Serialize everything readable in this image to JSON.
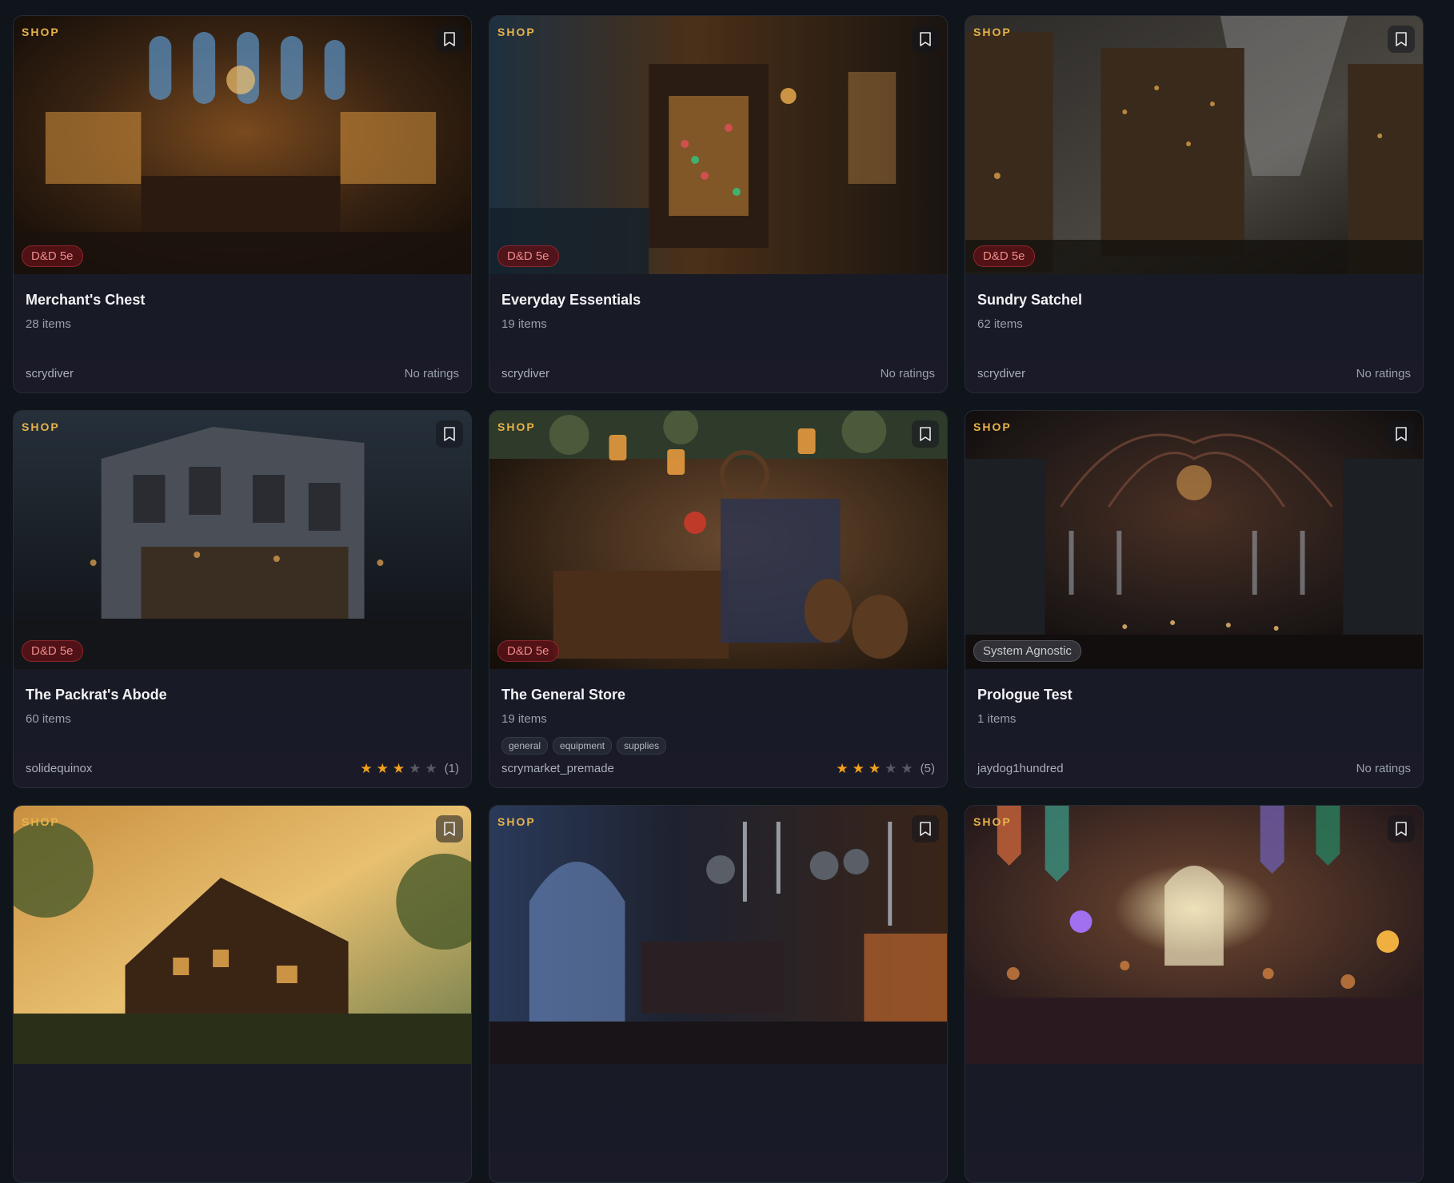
{
  "colors": {
    "accent": "#e7b24a",
    "badge_dnd": "#f08a8a",
    "star": "#f2a11c"
  },
  "cards": [
    {
      "label": "SHOP",
      "system": "D&D 5e",
      "system_type": "dnd",
      "title": "Merchant's Chest",
      "items": "28 items",
      "author": "scrydiver",
      "rating_text": "No ratings",
      "stars": 0,
      "rating_count": "",
      "tags": [],
      "image": "warm-shop-interior"
    },
    {
      "label": "SHOP",
      "system": "D&D 5e",
      "system_type": "dnd",
      "title": "Everyday Essentials",
      "items": "19 items",
      "author": "scrydiver",
      "rating_text": "No ratings",
      "stars": 0,
      "rating_count": "",
      "tags": [],
      "image": "potion-storefront"
    },
    {
      "label": "SHOP",
      "system": "D&D 5e",
      "system_type": "dnd",
      "title": "Sundry Satchel",
      "items": "62 items",
      "author": "scrydiver",
      "rating_text": "No ratings",
      "stars": 0,
      "rating_count": "",
      "tags": [],
      "image": "tall-shelves-hall"
    },
    {
      "label": "SHOP",
      "system": "D&D 5e",
      "system_type": "dnd",
      "title": "The Packrat's Abode",
      "items": "60 items",
      "author": "solidequinox",
      "rating_text": "",
      "stars": 3,
      "rating_count": "(1)",
      "tags": [],
      "image": "stone-house-night"
    },
    {
      "label": "SHOP",
      "system": "D&D 5e",
      "system_type": "dnd",
      "title": "The General Store",
      "items": "19 items",
      "author": "scrymarket_premade",
      "rating_text": "",
      "stars": 3,
      "rating_count": "(5)",
      "tags": [
        "general",
        "equipment",
        "supplies"
      ],
      "image": "lantern-general-store"
    },
    {
      "label": "SHOP",
      "system": "System Agnostic",
      "system_type": "agnostic",
      "title": "Prologue Test",
      "items": "1 items",
      "author": "jaydog1hundred",
      "rating_text": "No ratings",
      "stars": 0,
      "rating_count": "",
      "tags": [],
      "image": "gothic-armory-hall"
    },
    {
      "label": "SHOP",
      "system": "",
      "system_type": "",
      "title": "",
      "items": "",
      "author": "",
      "rating_text": "",
      "stars": 0,
      "rating_count": "",
      "tags": [],
      "image": "cottage-sunset"
    },
    {
      "label": "SHOP",
      "system": "",
      "system_type": "",
      "title": "",
      "items": "",
      "author": "",
      "rating_text": "",
      "stars": 0,
      "rating_count": "",
      "tags": [],
      "image": "blacksmith-forge"
    },
    {
      "label": "SHOP",
      "system": "",
      "system_type": "",
      "title": "",
      "items": "",
      "author": "",
      "rating_text": "",
      "stars": 0,
      "rating_count": "",
      "tags": [],
      "image": "alchemy-shop-banners"
    }
  ]
}
